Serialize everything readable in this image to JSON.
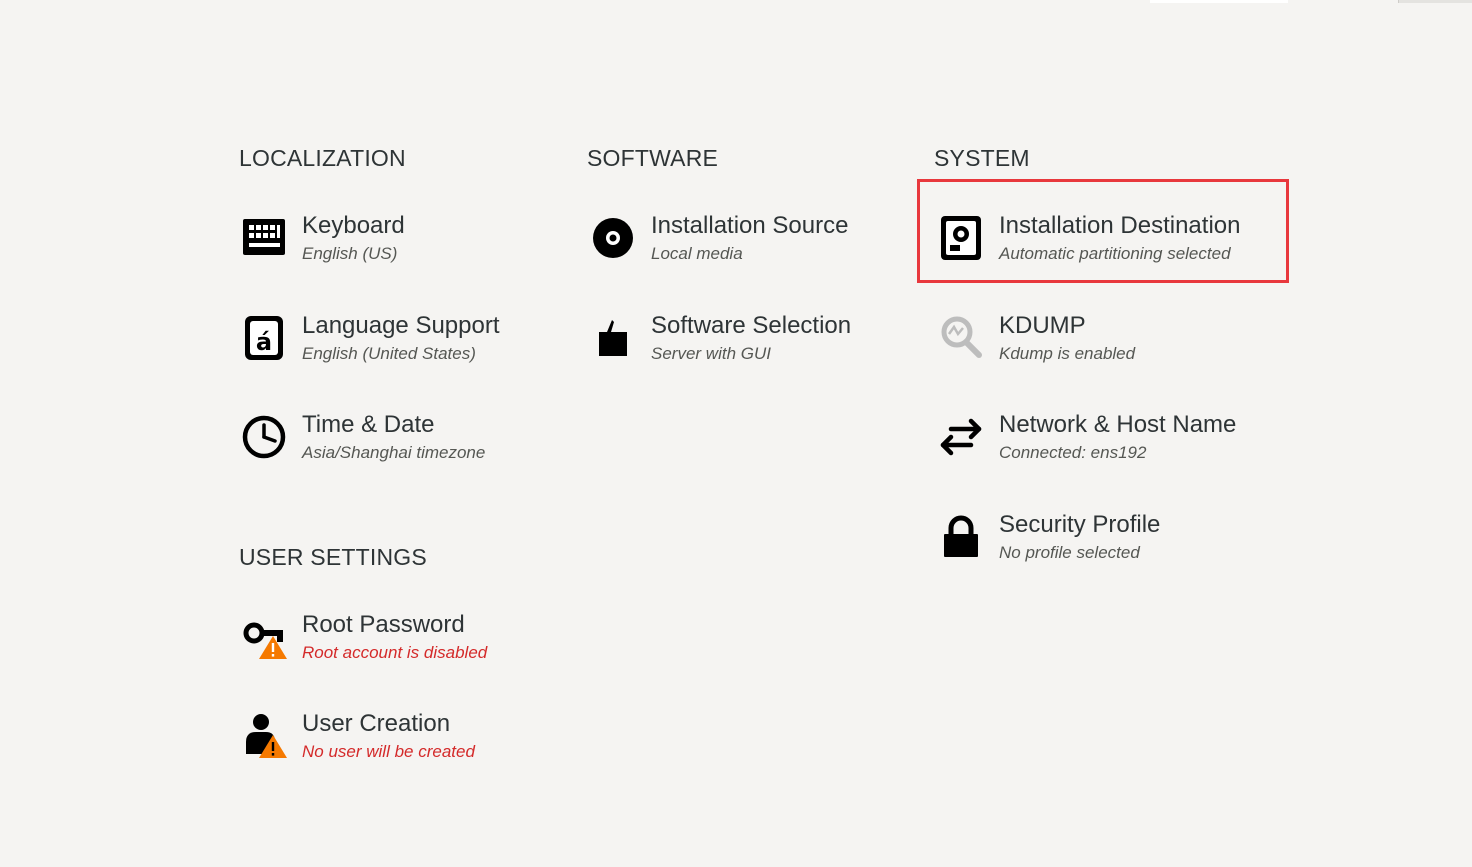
{
  "sections": {
    "localization": "LOCALIZATION",
    "software": "SOFTWARE",
    "system": "SYSTEM",
    "user_settings": "USER SETTINGS"
  },
  "spokes": {
    "keyboard": {
      "title": "Keyboard",
      "status": "English (US)",
      "icon": "keyboard-icon"
    },
    "language": {
      "title": "Language Support",
      "status": "English (United States)",
      "icon": "language-icon"
    },
    "time": {
      "title": "Time & Date",
      "status": "Asia/Shanghai timezone",
      "icon": "clock-icon"
    },
    "source": {
      "title": "Installation Source",
      "status": "Local media",
      "icon": "disc-icon"
    },
    "software": {
      "title": "Software Selection",
      "status": "Server with GUI",
      "icon": "package-icon"
    },
    "destination": {
      "title": "Installation Destination",
      "status": "Automatic partitioning selected",
      "icon": "hard-drive-icon"
    },
    "kdump": {
      "title": "KDUMP",
      "status": "Kdump is enabled",
      "icon": "magnifier-icon"
    },
    "network": {
      "title": "Network & Host Name",
      "status": "Connected: ens192",
      "icon": "network-arrows-icon"
    },
    "security": {
      "title": "Security Profile",
      "status": "No profile selected",
      "icon": "lock-icon"
    },
    "root": {
      "title": "Root Password",
      "status": "Root account is disabled",
      "icon": "key-warning-icon"
    },
    "user": {
      "title": "User Creation",
      "status": "No user will be created",
      "icon": "user-warning-icon"
    }
  },
  "colors": {
    "background": "#f5f4f2",
    "text": "#2e3436",
    "status": "#555753",
    "warning_status": "#d42a2a",
    "highlight": "#e8383d",
    "warning_badge": "#f57900"
  }
}
